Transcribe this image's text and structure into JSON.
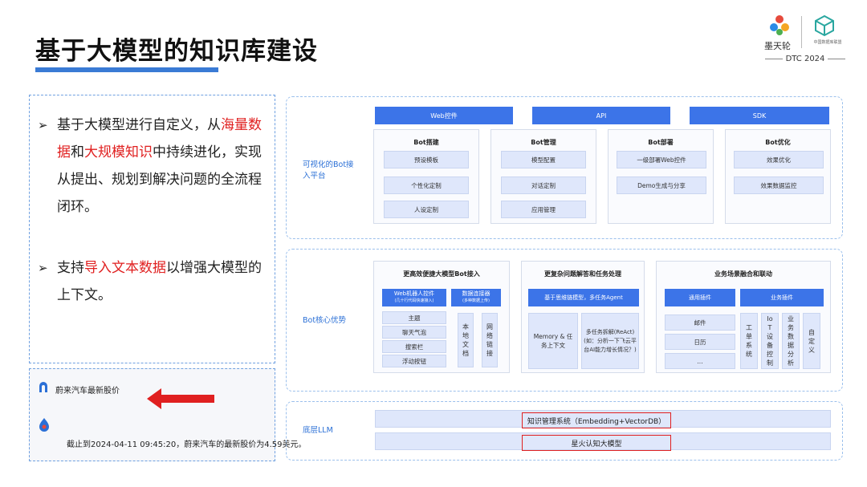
{
  "page": {
    "title": "基于大模型的知识库建设"
  },
  "logos": {
    "tian_text": "墨天轮",
    "dtc_sub": "中国数据库联盟",
    "dtc_event": "DTC 2024"
  },
  "left": {
    "bullet1": {
      "mark": "➢",
      "parts": [
        "基于大模型进行自定义，从",
        "海量数据",
        "和",
        "大规模知识",
        "中持续进化，实现从提出、规划到解决问题的全流程闭环。"
      ]
    },
    "bullet2": {
      "mark": "➢",
      "parts": [
        "支持",
        "导入文本数据",
        "以增强大模型的上下文。"
      ]
    }
  },
  "chat": {
    "question": "蔚来汽车最新股价",
    "answer": "截止到2024-04-11 09:45:20，蔚来汽车的最新股价为4.59美元。",
    "arrow_color": "#e02020"
  },
  "panel1": {
    "label": "可视化的Bot接入平台",
    "top_bars": [
      "Web控件",
      "API",
      "SDK"
    ],
    "columns": [
      {
        "title": "Bot搭建",
        "items": [
          "预设模板",
          "个性化定制",
          "人设定制"
        ]
      },
      {
        "title": "Bot管理",
        "items": [
          "模型配置",
          "对话定制",
          "应用管理"
        ]
      },
      {
        "title": "Bot部署",
        "items": [
          "一级部署Web控件",
          "Demo生成与分享"
        ]
      },
      {
        "title": "Bot优化",
        "items": [
          "效果优化",
          "效果数据监控"
        ]
      }
    ]
  },
  "panel2": {
    "label": "Bot核心优势",
    "group1": {
      "title": "更高效便捷大模型Bot接入",
      "sub1": "Web机器人控件",
      "sub1_note": "(几十行代码快速接入)",
      "sub2": "数据连接器",
      "sub2_note": "(多种数据上传)",
      "items": [
        "主题",
        "聊天气泡",
        "搜索栏",
        "浮动按钮"
      ],
      "v1": "本地文档",
      "v2": "网络链接"
    },
    "group2": {
      "title": "更复杂问题解答和任务处理",
      "sub": "基于思维链模型，多任务Agent",
      "left": "Memory & 任务上下文",
      "right": "多任务拆解(ReAct) (如：分析一下飞云平台AI能力增长情况？)"
    },
    "group3": {
      "title": "业务场景融合和联动",
      "sub1": "通用插件",
      "sub2": "业务插件",
      "items": [
        "邮件",
        "日历",
        "..."
      ],
      "verticals": [
        "工单系统",
        "IoT设备控制",
        "业务数据分析",
        "自定义"
      ]
    }
  },
  "panel3": {
    "label": "底层LLM",
    "row1": "知识管理系统（Embedding+VectorDB）",
    "row2": "星火认知大模型"
  },
  "colors": {
    "accent_blue": "#3c74e8",
    "highlight_red": "#e02020",
    "light_blue": "#dfe7fb"
  }
}
